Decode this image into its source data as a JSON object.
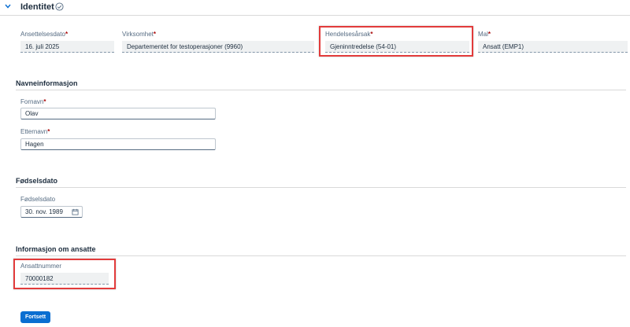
{
  "section": {
    "title": "Identitet"
  },
  "top_fields": [
    {
      "label": "Ansettelsesdato",
      "value": "16. juli 2025",
      "required": "*"
    },
    {
      "label": "Virksomhet",
      "value": "Departementet for testoperasjoner (9960)",
      "required": "*"
    },
    {
      "label": "Hendelsesårsak",
      "value": "Gjeninntredelse (54-01)",
      "required": "*"
    },
    {
      "label": "Mal",
      "value": "Ansatt (EMP1)",
      "required": "*"
    }
  ],
  "name_group": {
    "title": "Navneinformasjon",
    "first_name": {
      "label": "Fornavn",
      "value": "Olav",
      "required": "*"
    },
    "last_name": {
      "label": "Etternavn",
      "value": "Hagen",
      "required": "*"
    }
  },
  "birth_group": {
    "title": "Fødselsdato",
    "birth_date": {
      "label": "Fødselsdato",
      "value": "30. nov. 1989"
    }
  },
  "employee_group": {
    "title": "Informasjon om ansatte",
    "employee_number": {
      "label": "Ansattnummer",
      "value": "70000182"
    }
  },
  "actions": {
    "continue_label": "Fortsett"
  },
  "colors": {
    "accent": "#0a6ed1",
    "required": "#aa0808",
    "highlight": "#e23b3b"
  },
  "icons": {
    "collapse": "chevron-down-icon",
    "status": "check-circle-icon",
    "date": "calendar-icon"
  }
}
